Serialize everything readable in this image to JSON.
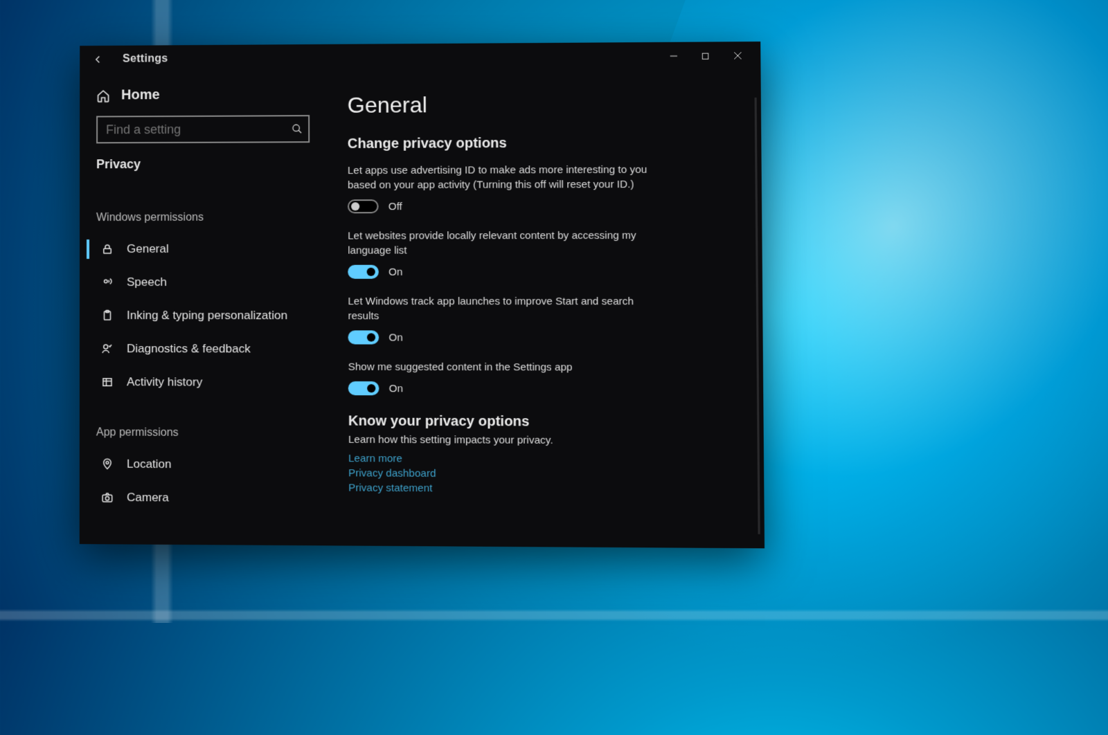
{
  "app_title": "Settings",
  "home_label": "Home",
  "search_placeholder": "Find a setting",
  "category": "Privacy",
  "sections": {
    "windows_permissions": "Windows permissions",
    "app_permissions": "App permissions"
  },
  "nav": {
    "general": "General",
    "speech": "Speech",
    "inking": "Inking & typing personalization",
    "diagnostics": "Diagnostics & feedback",
    "activity": "Activity history",
    "location": "Location",
    "camera": "Camera"
  },
  "page": {
    "title": "General",
    "subtitle": "Change privacy options",
    "settings": {
      "advertising_id": {
        "text": "Let apps use advertising ID to make ads more interesting to you based on your app activity (Turning this off will reset your ID.)",
        "state": "Off"
      },
      "language_list": {
        "text": "Let websites provide locally relevant content by accessing my language list",
        "state": "On"
      },
      "track_launches": {
        "text": "Let Windows track app launches to improve Start and search results",
        "state": "On"
      },
      "suggested_content": {
        "text": "Show me suggested content in the Settings app",
        "state": "On"
      }
    },
    "know": {
      "heading": "Know your privacy options",
      "subtext": "Learn how this setting impacts your privacy.",
      "links": {
        "learn_more": "Learn more",
        "dashboard": "Privacy dashboard",
        "statement": "Privacy statement"
      }
    }
  }
}
